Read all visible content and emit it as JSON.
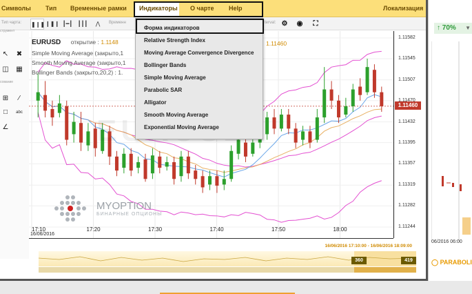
{
  "menubar": {
    "items": [
      "Символы",
      "Тип",
      "Временные рамки",
      "Индикаторы",
      "О чарте",
      "Help"
    ],
    "right": "Локализация"
  },
  "toolbar": {
    "chart_type_label": "Тип чарта:",
    "time_label": "Временн",
    "interval_label": "terval:"
  },
  "lefttools": {
    "tools_label": "струмент",
    "drawing_label": "сование"
  },
  "legend": {
    "symbol": "EURUSD",
    "open_label": "открытие :",
    "open_value": "1.1148",
    "indicators": [
      "Simple Moving Average (закрыто,1",
      "Smooth Moving Average (закрыто,1",
      "Bollinger Bands (закрыто,20,2) : 1."
    ],
    "secondary_value": "1.11460"
  },
  "dropdown": {
    "items": [
      "Форма индикаторов",
      "Relative Strength Index",
      "Moving Average Convergence Divergence",
      "Bollinger Bands",
      "Simple Moving Average",
      "Parabolic SAR",
      "Alligator",
      "Smooth Moving Average",
      "Exponential Moving Average"
    ]
  },
  "watermark": "EURUSD",
  "logo": {
    "name": "MYOPTION",
    "sub": "БИНАРНЫЕ ОПЦИОНЫ"
  },
  "chart_data": {
    "type": "candlestick",
    "symbol": "EURUSD",
    "current_price": "1.11460",
    "yticks": [
      "1.11582",
      "1.11545",
      "1.11507",
      "1.11470",
      "1.11432",
      "1.11395",
      "1.11357",
      "1.11319",
      "1.11282",
      "1.11244"
    ],
    "xticks": [
      "17:10",
      "17:20",
      "17:30",
      "17:40",
      "17:50",
      "18:00"
    ],
    "date": "16/06/2016",
    "candles": [
      {
        "o": 1.1147,
        "c": 1.11485,
        "h": 1.1152,
        "l": 1.1144
      },
      {
        "o": 1.1148,
        "c": 1.11452,
        "h": 1.11505,
        "l": 1.1144
      },
      {
        "o": 1.11455,
        "c": 1.1144,
        "h": 1.1147,
        "l": 1.11425
      },
      {
        "o": 1.11448,
        "c": 1.11465,
        "h": 1.1148,
        "l": 1.1144
      },
      {
        "o": 1.1146,
        "c": 1.114,
        "h": 1.1147,
        "l": 1.1139
      },
      {
        "o": 1.1141,
        "c": 1.11432,
        "h": 1.1145,
        "l": 1.11395
      },
      {
        "o": 1.1143,
        "c": 1.11395,
        "h": 1.1145,
        "l": 1.1138
      },
      {
        "o": 1.1139,
        "c": 1.11415,
        "h": 1.1143,
        "l": 1.1138
      },
      {
        "o": 1.1142,
        "c": 1.11385,
        "h": 1.1143,
        "l": 1.1137
      },
      {
        "o": 1.1138,
        "c": 1.11418,
        "h": 1.1143,
        "l": 1.11375
      },
      {
        "o": 1.11415,
        "c": 1.1137,
        "h": 1.11425,
        "l": 1.11355
      },
      {
        "o": 1.1137,
        "c": 1.11345,
        "h": 1.1138,
        "l": 1.11335
      },
      {
        "o": 1.1135,
        "c": 1.11375,
        "h": 1.11385,
        "l": 1.1134
      },
      {
        "o": 1.11375,
        "c": 1.11345,
        "h": 1.11385,
        "l": 1.11335
      },
      {
        "o": 1.1135,
        "c": 1.1136,
        "h": 1.1137,
        "l": 1.1134
      },
      {
        "o": 1.11365,
        "c": 1.1133,
        "h": 1.11375,
        "l": 1.11325
      },
      {
        "o": 1.1134,
        "c": 1.11372,
        "h": 1.11385,
        "l": 1.1133
      },
      {
        "o": 1.1137,
        "c": 1.1135,
        "h": 1.1138,
        "l": 1.1134
      },
      {
        "o": 1.11352,
        "c": 1.1136,
        "h": 1.1137,
        "l": 1.11345
      },
      {
        "o": 1.1136,
        "c": 1.1133,
        "h": 1.1137,
        "l": 1.1132
      },
      {
        "o": 1.11335,
        "c": 1.1137,
        "h": 1.1138,
        "l": 1.11325
      },
      {
        "o": 1.1137,
        "c": 1.1134,
        "h": 1.1138,
        "l": 1.1133
      },
      {
        "o": 1.11345,
        "c": 1.1133,
        "h": 1.11355,
        "l": 1.1132
      },
      {
        "o": 1.11335,
        "c": 1.11315,
        "h": 1.11345,
        "l": 1.11305
      },
      {
        "o": 1.1132,
        "c": 1.11335,
        "h": 1.11345,
        "l": 1.1131
      },
      {
        "o": 1.11335,
        "c": 1.11318,
        "h": 1.11345,
        "l": 1.11305
      },
      {
        "o": 1.1132,
        "c": 1.1133,
        "h": 1.11345,
        "l": 1.1131
      },
      {
        "o": 1.1133,
        "c": 1.1138,
        "h": 1.1139,
        "l": 1.11325
      },
      {
        "o": 1.11375,
        "c": 1.114,
        "h": 1.1141,
        "l": 1.11365
      },
      {
        "o": 1.11395,
        "c": 1.1137,
        "h": 1.11405,
        "l": 1.1136
      },
      {
        "o": 1.11375,
        "c": 1.11395,
        "h": 1.11405,
        "l": 1.1137
      },
      {
        "o": 1.11395,
        "c": 1.1141,
        "h": 1.1142,
        "l": 1.11385
      },
      {
        "o": 1.1141,
        "c": 1.1144,
        "h": 1.1145,
        "l": 1.114
      },
      {
        "o": 1.1144,
        "c": 1.1142,
        "h": 1.11455,
        "l": 1.1141
      },
      {
        "o": 1.1142,
        "c": 1.11445,
        "h": 1.11455,
        "l": 1.11415
      },
      {
        "o": 1.11445,
        "c": 1.1142,
        "h": 1.11455,
        "l": 1.1141
      },
      {
        "o": 1.1142,
        "c": 1.11395,
        "h": 1.1143,
        "l": 1.11385
      },
      {
        "o": 1.114,
        "c": 1.11415,
        "h": 1.11425,
        "l": 1.1139
      },
      {
        "o": 1.11415,
        "c": 1.11395,
        "h": 1.11425,
        "l": 1.11385
      },
      {
        "o": 1.114,
        "c": 1.1144,
        "h": 1.11455,
        "l": 1.11395
      },
      {
        "o": 1.1144,
        "c": 1.1149,
        "h": 1.1153,
        "l": 1.1143
      },
      {
        "o": 1.1149,
        "c": 1.1147,
        "h": 1.11505,
        "l": 1.11455
      },
      {
        "o": 1.1147,
        "c": 1.1144,
        "h": 1.1148,
        "l": 1.1143
      },
      {
        "o": 1.11445,
        "c": 1.1146,
        "h": 1.11475,
        "l": 1.1144
      },
      {
        "o": 1.1146,
        "c": 1.1149,
        "h": 1.115,
        "l": 1.1145
      },
      {
        "o": 1.11495,
        "c": 1.1148,
        "h": 1.1151,
        "l": 1.1147
      },
      {
        "o": 1.11485,
        "c": 1.1153,
        "h": 1.11545,
        "l": 1.1148
      },
      {
        "o": 1.11525,
        "c": 1.11485,
        "h": 1.11535,
        "l": 1.11475
      },
      {
        "o": 1.11485,
        "c": 1.1146,
        "h": 1.11495,
        "l": 1.1145
      }
    ]
  },
  "range": {
    "label": "16/06/2016 17:10:00 - 16/06/2016 18:09:00",
    "left_handle": "360",
    "right_handle": "419"
  },
  "background": {
    "percent": "70%",
    "date_label": "06/2016 06:00",
    "parabolic": "PARABOLIC"
  },
  "colors": {
    "menubar": "#fcdf7a",
    "bull": "#2ca02c",
    "bear": "#c0392b",
    "bollinger": "#e34fd1",
    "sma": "#6aa6e8",
    "smooth": "#e8b063",
    "price_line": "#c0392b"
  }
}
